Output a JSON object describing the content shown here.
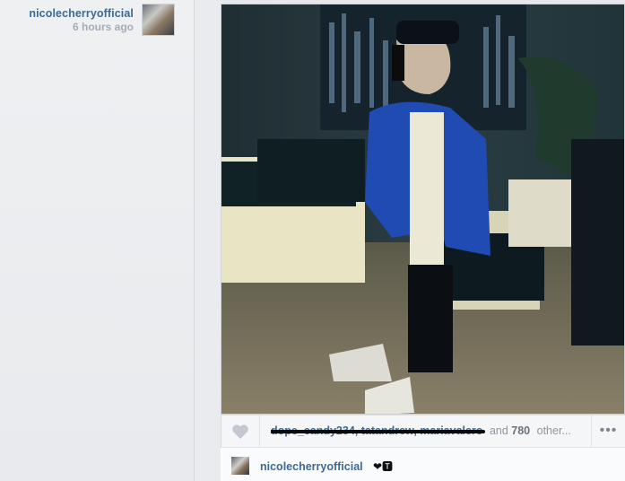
{
  "post_header": {
    "username": "nicolecherryofficial",
    "timestamp": "6 hours ago"
  },
  "likes": {
    "names": "dope_candy234, tatandrew, mariavalero",
    "and_label": "and",
    "count": "780",
    "others_label": "other..."
  },
  "more_label": "•••",
  "caption": {
    "username": "nicolecherryofficial",
    "emoji": "❤🆃"
  },
  "colors": {
    "link_blue": "#3d6a96",
    "muted_gray": "#a5adb7",
    "page_bg": "#e6e8eb"
  },
  "icons": [
    "heart-icon",
    "more-icon"
  ]
}
